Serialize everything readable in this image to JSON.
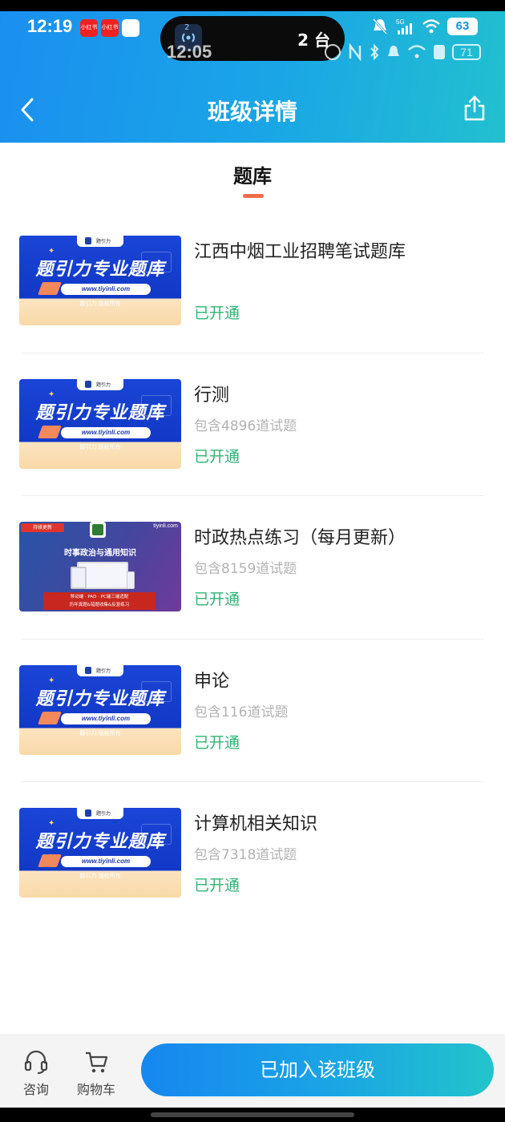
{
  "status_bar": {
    "time": "12:19",
    "app_badges": [
      "小红书",
      "小红书"
    ],
    "island_count_sup": "2",
    "island_text": "2 台",
    "network": "5G",
    "battery": "63"
  },
  "ghost_status_bar": {
    "time": "12:05",
    "battery": "71"
  },
  "nav": {
    "title": "班级详情",
    "back_icon": "chevron-left-icon",
    "share_icon": "share-icon"
  },
  "section": {
    "tab_label": "题库"
  },
  "thumbnail": {
    "tab_text": "题引力",
    "title": "题引力专业题库",
    "url": "www.tiyinli.com",
    "copyright": "题引力 版权所有"
  },
  "news_thumbnail": {
    "badge": "持续更新",
    "site": "tiyinli.com",
    "heading": "时事政治与通用知识",
    "banner_line1": "移动端 · PAD · PC端三端适配",
    "banner_line2": "历年真题&错题收集&反复练习"
  },
  "courses": [
    {
      "title": "江西中烟工业招聘笔试题库",
      "count": "",
      "status": "已开通",
      "thumb": "default"
    },
    {
      "title": "行测",
      "count": "包含4896道试题",
      "status": "已开通",
      "thumb": "default"
    },
    {
      "title": "时政热点练习（每月更新）",
      "count": "包含8159道试题",
      "status": "已开通",
      "thumb": "news"
    },
    {
      "title": "申论",
      "count": "包含116道试题",
      "status": "已开通",
      "thumb": "default"
    },
    {
      "title": "计算机相关知识",
      "count": "包含7318道试题",
      "status": "已开通",
      "thumb": "default"
    }
  ],
  "bottom_bar": {
    "consult_label": "咨询",
    "cart_label": "购物车",
    "join_button": "已加入该班级"
  },
  "colors": {
    "header_start": "#1a8ff0",
    "header_end": "#22c0cf",
    "status_open": "#2bb673",
    "tab_underline": "#ef6b4a"
  }
}
